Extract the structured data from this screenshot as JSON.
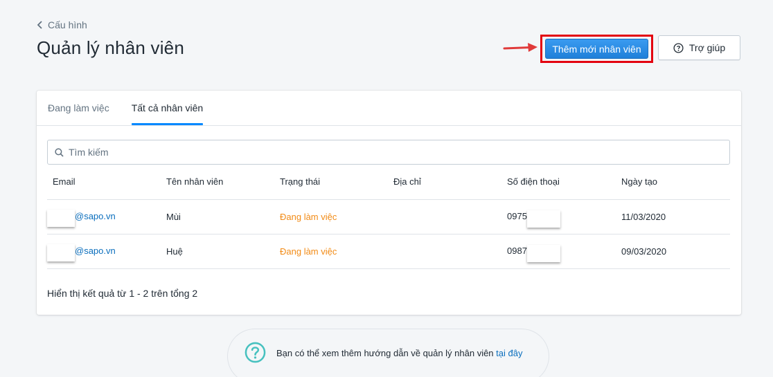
{
  "header": {
    "back_label": "Cấu hình",
    "title": "Quản lý nhân viên",
    "add_button_label": "Thêm mới nhân viên",
    "help_button_label": "Trợ giúp"
  },
  "tabs": [
    {
      "label": "Đang làm việc",
      "active": false
    },
    {
      "label": "Tất cả nhân viên",
      "active": true
    }
  ],
  "search": {
    "placeholder": "Tìm kiếm",
    "value": ""
  },
  "table": {
    "columns": [
      "Email",
      "Tên nhân viên",
      "Trạng thái",
      "Địa chỉ",
      "Số điện thoại",
      "Ngày tạo"
    ],
    "rows": [
      {
        "email_visible": "@sapo.vn",
        "name": "Mùi",
        "status": "Đang làm việc",
        "address": "",
        "phone_visible": "0975",
        "created": "11/03/2020"
      },
      {
        "email_visible": "@sapo.vn",
        "name": "Huệ",
        "status": "Đang làm việc",
        "address": "",
        "phone_visible": "0987",
        "created": "09/03/2020"
      }
    ]
  },
  "pagination_text": "Hiển thị kết quả từ 1 - 2 trên tổng 2",
  "help_banner": {
    "text": "Bạn có thể xem thêm hướng dẫn về quản lý nhân viên ",
    "link_label": "tại đây"
  },
  "colors": {
    "primary": "#1f80d9",
    "highlight_border": "#e3000f",
    "status_active": "#f28b16",
    "link": "#0a6ebd",
    "tab_indicator": "#0088ff"
  },
  "icons": [
    "chevron-left-icon",
    "arrow-right-icon",
    "help-circle-icon",
    "search-icon",
    "question-circle-icon"
  ]
}
